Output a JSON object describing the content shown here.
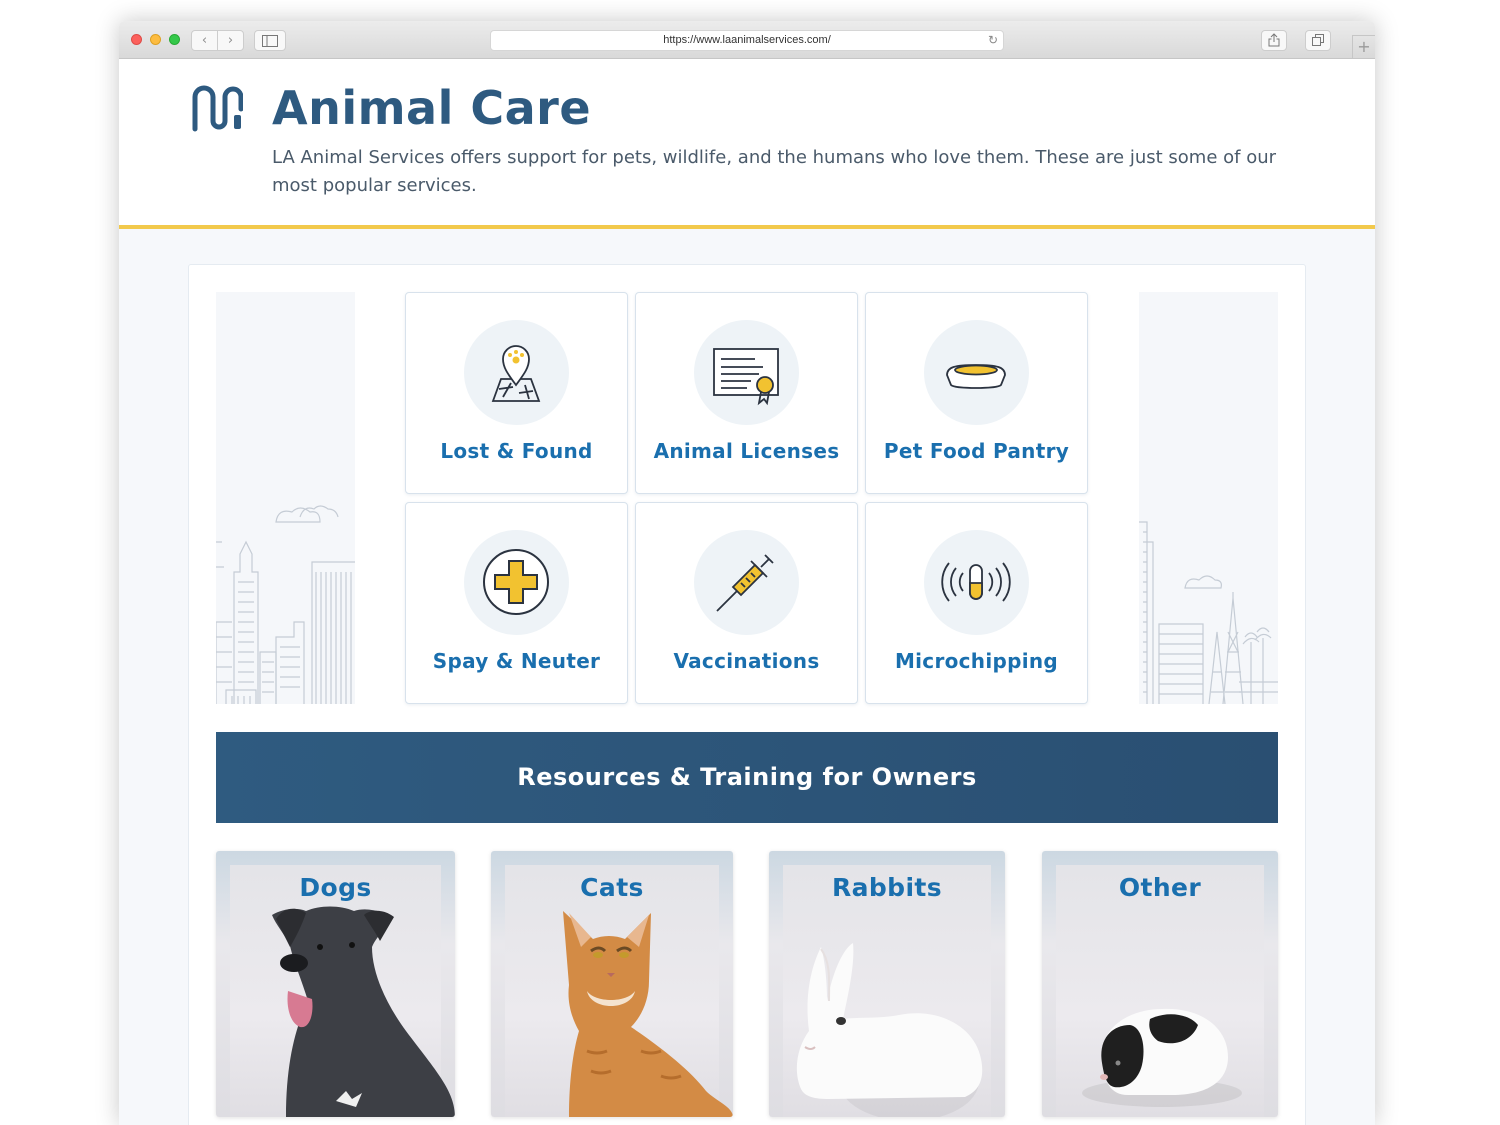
{
  "browser": {
    "url": "https://www.laanimalservices.com/"
  },
  "header": {
    "title": "Animal Care",
    "intro": "LA Animal Services offers support for pets, wildlife, and the humans who love them. These are just some of our most popular services."
  },
  "services": [
    {
      "label": "Lost & Found",
      "icon": "map-pin-paw-icon"
    },
    {
      "label": "Animal Licenses",
      "icon": "certificate-icon"
    },
    {
      "label": "Pet Food Pantry",
      "icon": "pet-bowl-icon"
    },
    {
      "label": "Spay & Neuter",
      "icon": "medical-cross-icon"
    },
    {
      "label": "Vaccinations",
      "icon": "syringe-icon"
    },
    {
      "label": "Microchipping",
      "icon": "microchip-icon"
    }
  ],
  "resources": {
    "heading": "Resources & Training for Owners",
    "cards": [
      {
        "label": "Dogs"
      },
      {
        "label": "Cats"
      },
      {
        "label": "Rabbits"
      },
      {
        "label": "Other"
      }
    ]
  },
  "colors": {
    "brand_blue": "#2e5a80",
    "link_blue": "#1a6fae",
    "accent_yellow": "#f2c94c"
  }
}
